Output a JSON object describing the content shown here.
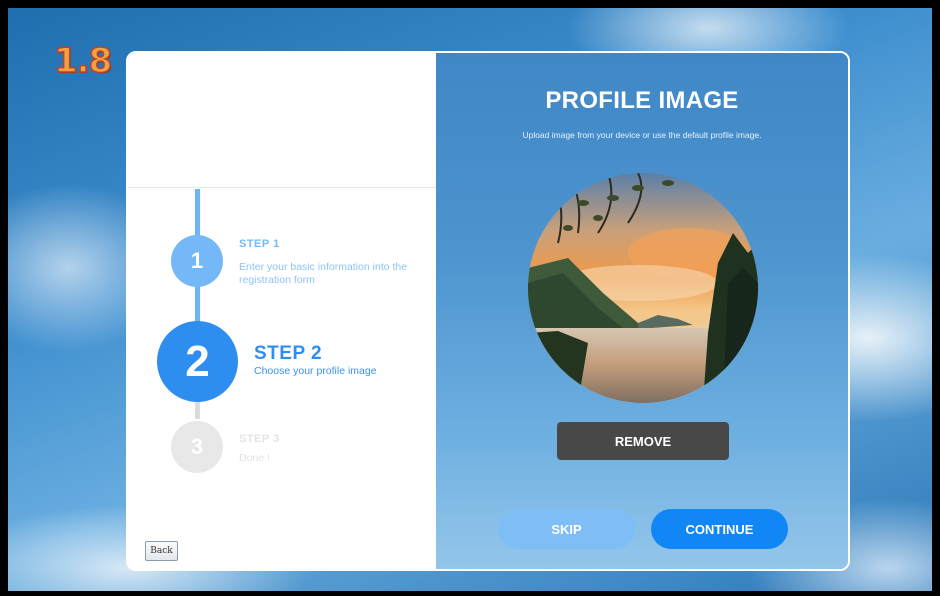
{
  "version_badge": "1.8",
  "steps": [
    {
      "number": "1",
      "title": "STEP 1",
      "description": "Enter your basic information into the registration form"
    },
    {
      "number": "2",
      "title": "STEP 2",
      "description": "Choose your profile image"
    },
    {
      "number": "3",
      "title": "STEP 3",
      "description": "Done !"
    }
  ],
  "back_label": "Back",
  "profile": {
    "title": "PROFILE IMAGE",
    "subtitle": "Upload image from your device or use the default profile image."
  },
  "buttons": {
    "remove": "REMOVE",
    "skip": "SKIP",
    "continue": "CONTINUE"
  },
  "colors": {
    "accent": "#2e8ef0",
    "continue": "#1187f5",
    "skip": "#7ebdf6",
    "remove": "#484848",
    "badge": "#f2a041"
  }
}
